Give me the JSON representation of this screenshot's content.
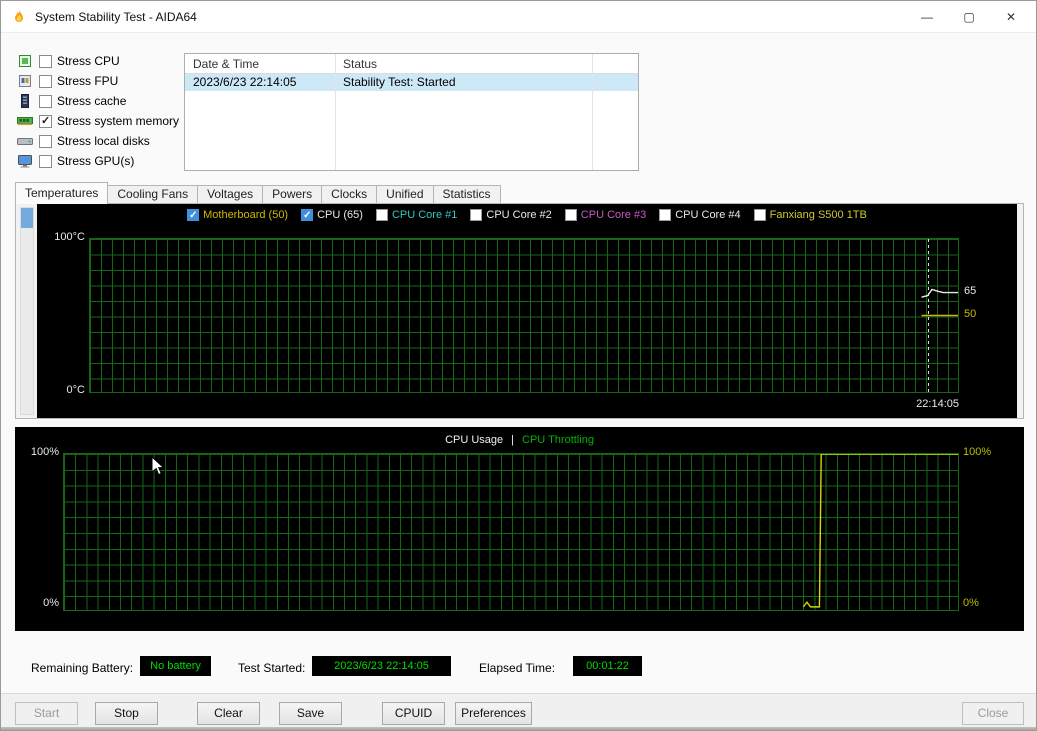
{
  "window": {
    "title": "System Stability Test - AIDA64",
    "minimize_glyph": "—",
    "maximize_glyph": "▢",
    "close_glyph": "✕"
  },
  "stress_options": [
    {
      "label": "Stress CPU",
      "checked": false
    },
    {
      "label": "Stress FPU",
      "checked": false
    },
    {
      "label": "Stress cache",
      "checked": false
    },
    {
      "label": "Stress system memory",
      "checked": true
    },
    {
      "label": "Stress local disks",
      "checked": false
    },
    {
      "label": "Stress GPU(s)",
      "checked": false
    }
  ],
  "log_table": {
    "columns": [
      "Date & Time",
      "Status"
    ],
    "rows": [
      {
        "datetime": "2023/6/23 22:14:05",
        "status": "Stability Test: Started"
      }
    ]
  },
  "tabs": [
    "Temperatures",
    "Cooling Fans",
    "Voltages",
    "Powers",
    "Clocks",
    "Unified",
    "Statistics"
  ],
  "active_tab": "Temperatures",
  "status_bar": {
    "battery_label": "Remaining Battery:",
    "battery_value": "No battery",
    "started_label": "Test Started:",
    "started_value": "2023/6/23 22:14:05",
    "elapsed_label": "Elapsed Time:",
    "elapsed_value": "00:01:22",
    "value_color": "#00dc00"
  },
  "buttons": {
    "start": "Start",
    "stop": "Stop",
    "clear": "Clear",
    "save": "Save",
    "cpuid": "CPUID",
    "preferences": "Preferences",
    "close": "Close"
  },
  "chart_data": [
    {
      "type": "line",
      "title": "Temperatures",
      "ylim": [
        0,
        100
      ],
      "y_axis_top_label": "100°C",
      "y_axis_bottom_label": "0°C",
      "x_time_label": "22:14:05",
      "grid": true,
      "grid_color": "#176617",
      "background": "#000000",
      "legend_position": "top",
      "legend": [
        {
          "label": "Motherboard (50)",
          "checked": true,
          "color": "#cdb800"
        },
        {
          "label": "CPU (65)",
          "checked": true,
          "color": "#e8e8e8"
        },
        {
          "label": "CPU Core #1",
          "checked": false,
          "color": "#2cc8c8"
        },
        {
          "label": "CPU Core #2",
          "checked": false,
          "color": "#e8e8e8"
        },
        {
          "label": "CPU Core #3",
          "checked": false,
          "color": "#c85ac8"
        },
        {
          "label": "CPU Core #4",
          "checked": false,
          "color": "#e8e8e8"
        },
        {
          "label": "Fanxiang S500 1TB",
          "checked": false,
          "color": "#cdc832"
        }
      ],
      "right_value_labels": [
        {
          "text": "65",
          "value": 65,
          "color": "#e8e8e8"
        },
        {
          "text": "50",
          "value": 50,
          "color": "#cdb800"
        }
      ],
      "event_line_x_frac": 0.966,
      "series": [
        {
          "name": "CPU (65)",
          "color": "#e8e8e8",
          "points": [
            [
              0.958,
              62
            ],
            [
              0.965,
              63
            ],
            [
              0.97,
              67
            ],
            [
              0.976,
              66
            ],
            [
              0.983,
              65
            ],
            [
              1,
              65
            ]
          ]
        },
        {
          "name": "Motherboard (50)",
          "color": "#cdb800",
          "points": [
            [
              0.958,
              50
            ],
            [
              1,
              50
            ]
          ]
        }
      ]
    },
    {
      "type": "line",
      "title_parts": [
        {
          "text": "CPU Usage",
          "color": "#f0f0f0"
        },
        {
          "text": "|",
          "color": "#f0f0f0"
        },
        {
          "text": "CPU Throttling",
          "color": "#00b400"
        }
      ],
      "ylim": [
        0,
        100
      ],
      "y_axis_top_label": "100%",
      "y_axis_bottom_label": "0%",
      "right_axis_top_label": "100%",
      "right_axis_bottom_label": "0%",
      "right_axis_color": "#bcbc00",
      "grid": true,
      "grid_color": "#176617",
      "background": "#000000",
      "series": [
        {
          "name": "CPU Usage",
          "color": "#d6d600",
          "points": [
            [
              0.827,
              2
            ],
            [
              0.831,
              5
            ],
            [
              0.835,
              2
            ],
            [
              0.845,
              2
            ],
            [
              0.847,
              100
            ],
            [
              1,
              100
            ]
          ]
        }
      ]
    }
  ]
}
